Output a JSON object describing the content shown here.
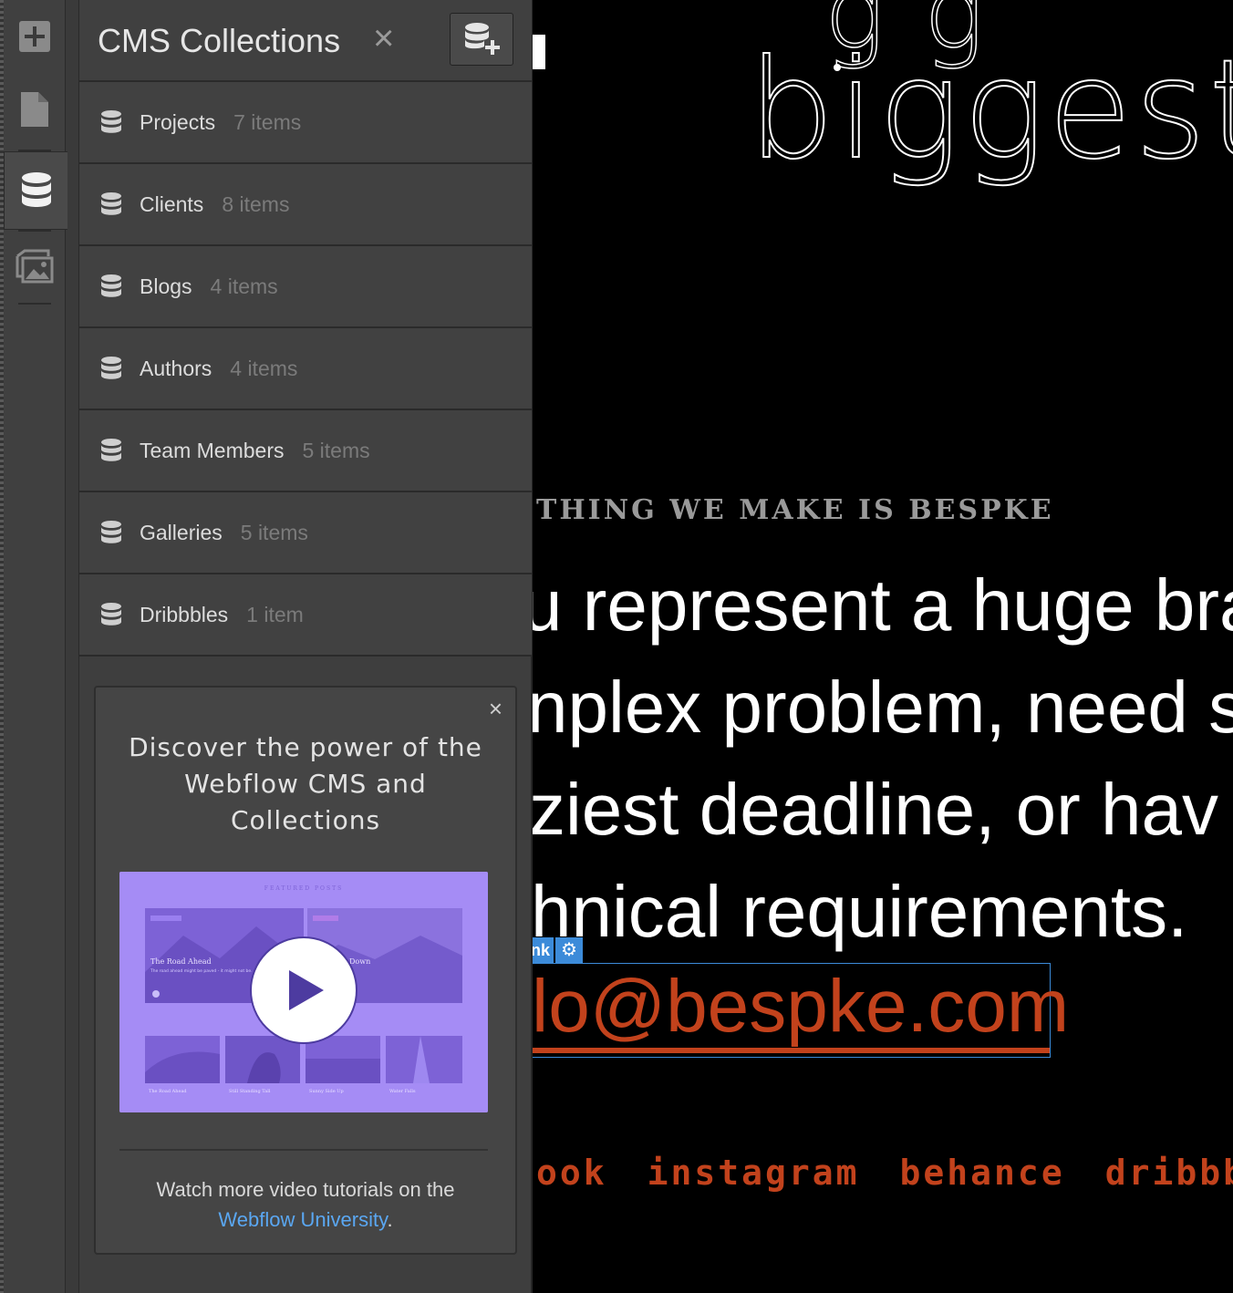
{
  "panel": {
    "title": "CMS Collections",
    "close_symbol": "×",
    "add_icon": "add-collection-icon"
  },
  "collections": [
    {
      "name": "Projects",
      "count": "7 items"
    },
    {
      "name": "Clients",
      "count": "8 items"
    },
    {
      "name": "Blogs",
      "count": "4 items"
    },
    {
      "name": "Authors",
      "count": "4 items"
    },
    {
      "name": "Team Members",
      "count": "5 items"
    },
    {
      "name": "Galleries",
      "count": "5 items"
    },
    {
      "name": "Dribbbles",
      "count": "1 item"
    }
  ],
  "promo": {
    "close_symbol": "×",
    "title": "Discover the power of the Webflow CMS and Collections",
    "footer_text": "Watch more video tutorials on the",
    "footer_link": "Webflow University",
    "footer_end": ".",
    "video": {
      "heading": "FEATURED POSTS",
      "post_title": "The Road Ahead",
      "post_desc": "The road ahead might be paved - it might not be.",
      "post_title_2": "Down",
      "thumbs": [
        "The Road Ahead",
        "Still Standing Tall",
        "Sunny Side Up",
        "Water Falls"
      ]
    }
  },
  "rail": {
    "icons": [
      "add-icon",
      "pages-icon",
      "cms-database-icon",
      "assets-icon"
    ],
    "active": "cms-database-icon"
  },
  "canvas": {
    "hero_partial": "g  g",
    "hero_word": "biggest p",
    "eyebrow": "THING WE MAKE IS BESPKE",
    "lines": [
      "u represent a huge bra",
      "nplex problem, need s",
      "ziest deadline, or hav",
      "hnical requirements."
    ],
    "link_tag_label": "nk",
    "email": "lo@bespke.com",
    "socials": [
      "ook",
      "instagram",
      "behance",
      "dribbbl"
    ]
  },
  "colors": {
    "accent_link": "#c2421c",
    "selection_blue": "#3c8bd9",
    "video_purple": "#a58cf5",
    "panel_bg": "#3e3e3e"
  }
}
